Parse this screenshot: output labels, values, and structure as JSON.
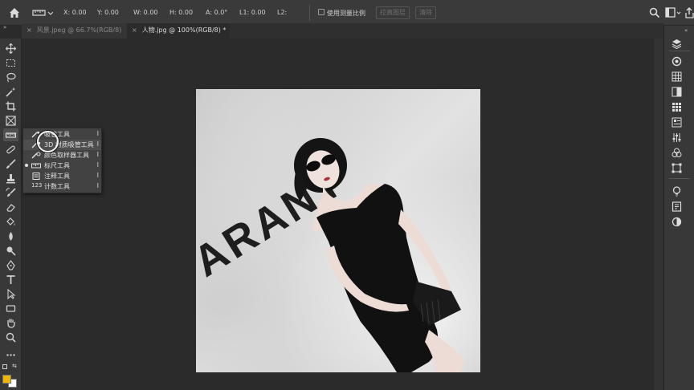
{
  "options_bar": {
    "x": "X: 0.00",
    "y": "Y: 0.00",
    "w": "W: 0.00",
    "h": "H: 0.00",
    "angle": "A: 0.0°",
    "l1": "L1: 0.00",
    "l2": "L2:",
    "scale_checkbox_label": "使用测量比例",
    "straighten_button": "拉直图层",
    "clear_button": "清除"
  },
  "tabs": [
    {
      "close": "×",
      "label": "风景.jpeg @ 66.7%(RGB/8)"
    },
    {
      "close": "×",
      "label": "人物.jpg @ 100%(RGB/8) *"
    }
  ],
  "flyout": {
    "items": [
      {
        "label": "吸管工具",
        "shortcut": "I",
        "selected": false,
        "active": false
      },
      {
        "label": "3D 材质吸管工具",
        "shortcut": "I",
        "selected": true,
        "active": false
      },
      {
        "label": "颜色取样器工具",
        "shortcut": "I",
        "selected": false,
        "active": false
      },
      {
        "label": "标尺工具",
        "shortcut": "I",
        "selected": false,
        "active": true
      },
      {
        "label": "注释工具",
        "shortcut": "I",
        "selected": false,
        "active": false
      },
      {
        "label": "计数工具",
        "shortcut": "I",
        "selected": false,
        "active": false
      }
    ],
    "count_icon_text": "123"
  },
  "photo": {
    "caption_text": "ARANT"
  },
  "colors": {
    "foreground_swatch": "#f1b400",
    "background_swatch": "#ffffff"
  }
}
